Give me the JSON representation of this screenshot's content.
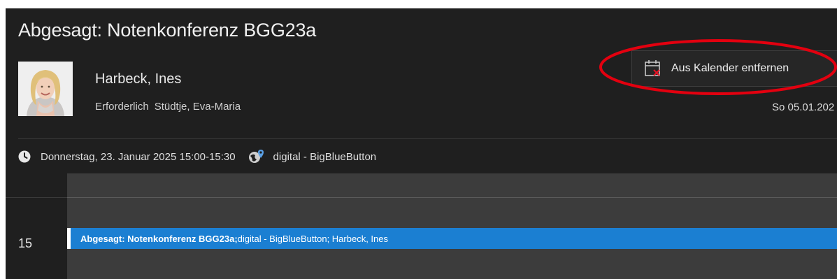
{
  "meeting": {
    "subject": "Abgesagt: Notenkonferenz BGG23a",
    "organizer": "Harbeck, Ines",
    "attendee_label": "Erforderlich",
    "attendee_name": "Stüdtje, Eva-Maria",
    "sent_date": "So 05.01.202",
    "when": "Donnerstag, 23. Januar 2025 15:00-15:30",
    "location": "digital - BigBlueButton"
  },
  "toolbar": {
    "remove_from_calendar_label": "Aus Kalender entfernen",
    "remove_icon": "calendar-x-icon"
  },
  "calendar": {
    "hour_label": "15",
    "event": {
      "title": "Abgesagt: Notenkonferenz BGG23a;",
      "details": " digital - BigBlueButton; Harbeck, Ines",
      "color": "#1b7fd2"
    }
  },
  "colors": {
    "background": "#1f1f1f",
    "highlight_ellipse": "#e3000f"
  }
}
